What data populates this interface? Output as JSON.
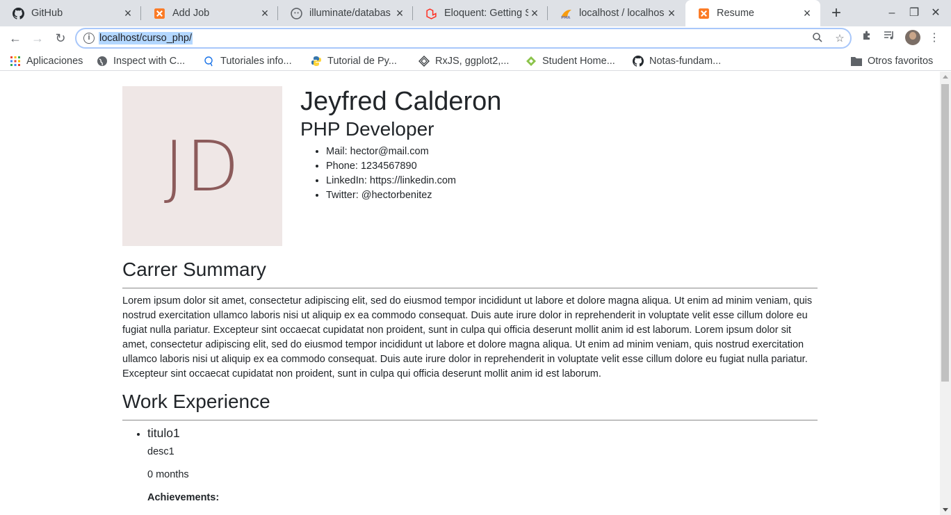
{
  "browser": {
    "tabs": [
      {
        "label": "GitHub",
        "icon": "github-icon"
      },
      {
        "label": "Add Job",
        "icon": "xampp-icon"
      },
      {
        "label": "illuminate/databas",
        "icon": "github-octocat-icon"
      },
      {
        "label": "Eloquent: Getting S",
        "icon": "laravel-icon"
      },
      {
        "label": "localhost / localhos",
        "icon": "phpmyadmin-icon"
      },
      {
        "label": "Resume",
        "icon": "xampp-icon",
        "active": true
      }
    ],
    "url": "localhost/curso_php/",
    "bookmarks": [
      {
        "label": "Aplicaciones",
        "icon": "apps-grid-icon"
      },
      {
        "label": "Inspect with C...",
        "icon": "globe-icon"
      },
      {
        "label": "Tutoriales info...",
        "icon": "search-bubble-icon"
      },
      {
        "label": "Tutorial de Py...",
        "icon": "python-icon"
      },
      {
        "label": "RxJS, ggplot2,...",
        "icon": "diamond-icon"
      },
      {
        "label": "Student Home...",
        "icon": "leaf-icon"
      },
      {
        "label": "Notas-fundam...",
        "icon": "github-icon"
      }
    ],
    "other_bookmarks": "Otros favoritos"
  },
  "resume": {
    "initials": "JD",
    "name": "Jeyfred Calderon",
    "role": "PHP Developer",
    "contacts": [
      "Mail: hector@mail.com",
      "Phone: 1234567890",
      "LinkedIn: https://linkedin.com",
      "Twitter: @hectorbenitez"
    ],
    "summary_title": "Carrer Summary",
    "summary": "Lorem ipsum dolor sit amet, consectetur adipiscing elit, sed do eiusmod tempor incididunt ut labore et dolore magna aliqua. Ut enim ad minim veniam, quis nostrud exercitation ullamco laboris nisi ut aliquip ex ea commodo consequat. Duis aute irure dolor in reprehenderit in voluptate velit esse cillum dolore eu fugiat nulla pariatur. Excepteur sint occaecat cupidatat non proident, sunt in culpa qui officia deserunt mollit anim id est laborum. Lorem ipsum dolor sit amet, consectetur adipiscing elit, sed do eiusmod tempor incididunt ut labore et dolore magna aliqua. Ut enim ad minim veniam, quis nostrud exercitation ullamco laboris nisi ut aliquip ex ea commodo consequat. Duis aute irure dolor in reprehenderit in voluptate velit esse cillum dolore eu fugiat nulla pariatur. Excepteur sint occaecat cupidatat non proident, sunt in culpa qui officia deserunt mollit anim id est laborum.",
    "work_title": "Work Experience",
    "jobs": [
      {
        "title": "titulo1",
        "description": "desc1",
        "duration": "0 months",
        "achievements_label": "Achievements:"
      }
    ]
  },
  "colors": {
    "tabstrip_bg": "#dee1e6",
    "photo_bg": "#efe7e6",
    "initials": "#8c5b5b",
    "url_highlight": "#b3d7ff",
    "xampp_orange": "#fb7a24",
    "laravel_red": "#ff2d20"
  }
}
